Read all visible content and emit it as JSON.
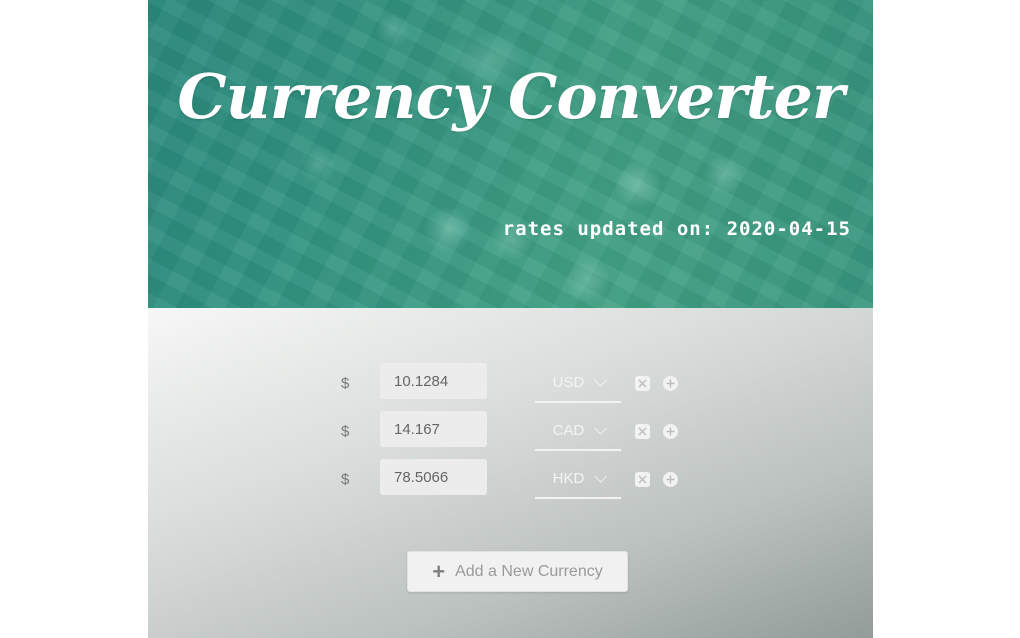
{
  "header": {
    "title": "Currency Converter",
    "rates_updated_label": "rates updated on: 2020-04-15",
    "theme_color": "#3a9c86"
  },
  "converter": {
    "rows": [
      {
        "symbol": "$",
        "amount": "10.1284",
        "currency": "USD"
      },
      {
        "symbol": "$",
        "amount": "14.167",
        "currency": "CAD"
      },
      {
        "symbol": "$",
        "amount": "78.5066",
        "currency": "HKD"
      }
    ],
    "remove_icon": "close-box-icon",
    "add_icon": "plus-circle-icon"
  },
  "add_currency_button": {
    "icon": "+",
    "label": "Add a New Currency"
  }
}
